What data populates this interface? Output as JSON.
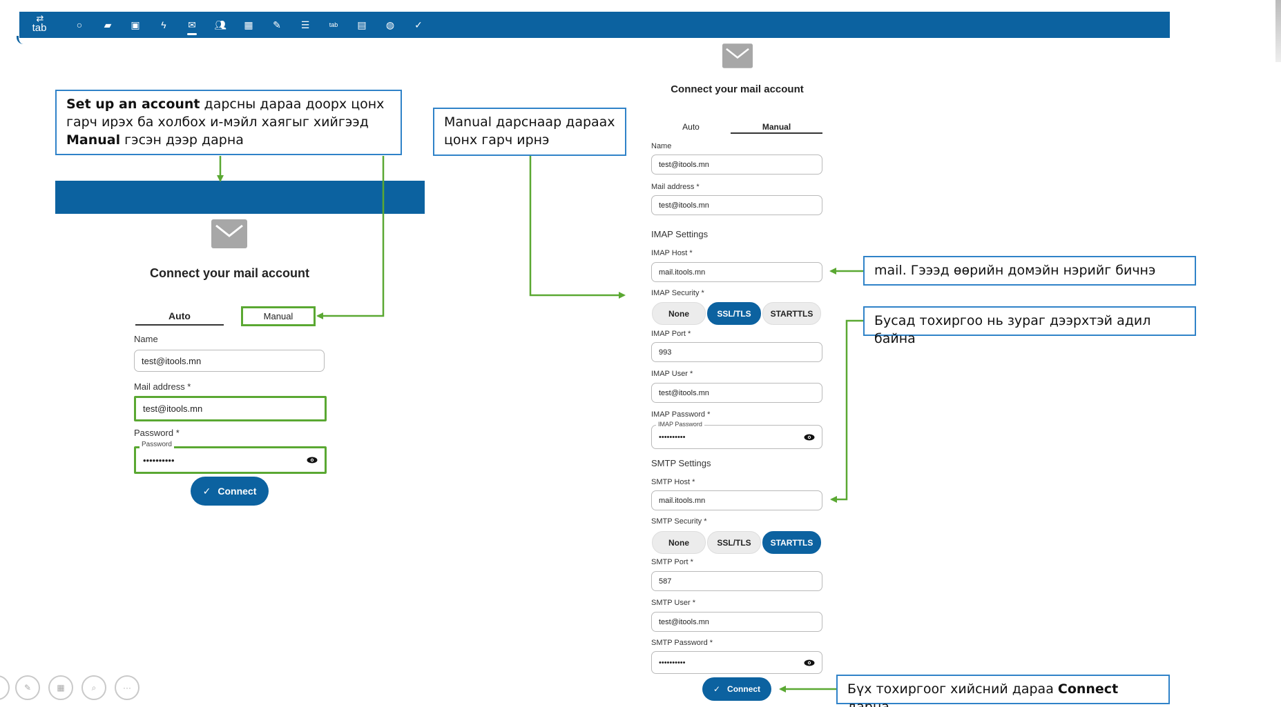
{
  "toolbar": {
    "logo_text": "tab",
    "icons": [
      "circle-icon",
      "folder-icon",
      "image-icon",
      "lightning-icon",
      "mail-icon",
      "users-icon",
      "calendar-icon",
      "pencil-icon",
      "stack-icon",
      "tab-icon",
      "gift-icon",
      "globe-icon",
      "check-icon"
    ],
    "active_icon": "mail-icon",
    "color": "#0c62a0"
  },
  "notes": {
    "setup": {
      "b1": "Set up an account",
      "t1": " дарсны дараа доорх цонх гарч ирэх ба холбох и-мэйл хаягыг хийгээд ",
      "b2": "Manual",
      "t2": " гэсэн дээр дарна"
    },
    "manual": "Manual дарснаар дараах цонх гарч ирнэ",
    "mail_host": "mail. Гэээд өөрийн домэйн нэрийг бичнэ",
    "others": "Бусад тохиргоо нь зураг дээрхтэй адил байна",
    "connect": {
      "t1": "Бүх тохиргоог хийсний дараа ",
      "b1": "Connect",
      "t2": " дарна"
    }
  },
  "auto_dialog": {
    "title": "Connect your mail account",
    "tab_auto": "Auto",
    "tab_manual": "Manual",
    "name_label": "Name",
    "name_value": "test@itools.mn",
    "mail_label": "Mail address *",
    "mail_value": "test@itools.mn",
    "password_label": "Password *",
    "password_legend": "Password",
    "password_value": "••••••••••",
    "connect_label": "Connect"
  },
  "manual_dialog": {
    "title": "Connect your mail account",
    "tab_auto": "Auto",
    "tab_manual": "Manual",
    "name_label": "Name",
    "name_value": "test@itools.mn",
    "mail_label": "Mail address *",
    "mail_value": "test@itools.mn",
    "imap": {
      "section": "IMAP Settings",
      "host_label": "IMAP Host *",
      "host_value": "mail.itools.mn",
      "security_label": "IMAP Security *",
      "security_options": [
        "None",
        "SSL/TLS",
        "STARTTLS"
      ],
      "security_selected": "SSL/TLS",
      "port_label": "IMAP Port *",
      "port_value": "993",
      "user_label": "IMAP User *",
      "user_value": "test@itools.mn",
      "password_label": "IMAP Password *",
      "password_legend": "IMAP Password",
      "password_value": "••••••••••"
    },
    "smtp": {
      "section": "SMTP Settings",
      "host_label": "SMTP Host *",
      "host_value": "mail.itools.mn",
      "security_label": "SMTP Security *",
      "security_options": [
        "None",
        "SSL/TLS",
        "STARTTLS"
      ],
      "security_selected": "STARTTLS",
      "port_label": "SMTP Port *",
      "port_value": "587",
      "user_label": "SMTP User *",
      "user_value": "test@itools.mn",
      "password_label": "SMTP Password *",
      "password_value": "••••••••••"
    },
    "connect_label": "Connect"
  },
  "colors": {
    "accent": "#0c62a0",
    "annotation_green": "#5aa832",
    "note_border": "#2f82c8"
  }
}
